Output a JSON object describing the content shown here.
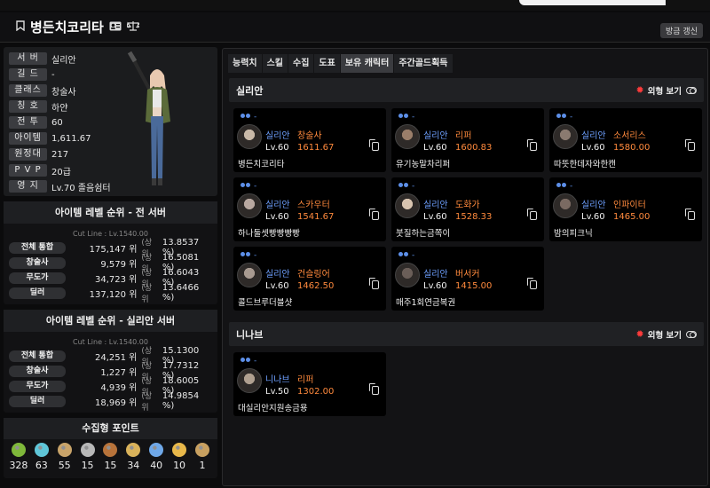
{
  "header": {
    "title": "병든치코리타",
    "refresh_label": "방금 갱신"
  },
  "profile": {
    "rows": [
      {
        "label": "서 버",
        "value": "실리안"
      },
      {
        "label": "길 드",
        "value": "-"
      },
      {
        "label": "클래스",
        "value": "창술사"
      },
      {
        "label": "칭 호",
        "value": "하얀"
      },
      {
        "label": "전 투",
        "value": "60"
      },
      {
        "label": "아이템",
        "value": "1,611.67"
      },
      {
        "label": "원정대",
        "value": "217"
      },
      {
        "label": "P V P",
        "value": "20급"
      },
      {
        "label": "영 지",
        "value": "Lv.70 졸음쉼터"
      }
    ]
  },
  "rank_all": {
    "title": "아이템 레벨 순위 - 전 서버",
    "cutline": "Cut Line : Lv.1540.00",
    "rows": [
      {
        "label": "전체 통합",
        "rank": "175,147 위",
        "top": "(상위",
        "pct": "13.8537 %)"
      },
      {
        "label": "창술사",
        "rank": "9,579 위",
        "top": "(상위",
        "pct": "16.5081 %)"
      },
      {
        "label": "무도가",
        "rank": "34,723 위",
        "top": "(상위",
        "pct": "16.6043 %)"
      },
      {
        "label": "딜러",
        "rank": "137,120 위",
        "top": "(상위",
        "pct": "13.6466 %)"
      }
    ]
  },
  "rank_server": {
    "title": "아이템 레벨 순위 - 실리안 서버",
    "cutline": "Cut Line : Lv.1540.00",
    "rows": [
      {
        "label": "전체 통합",
        "rank": "24,251 위",
        "top": "(상위",
        "pct": "15.1300 %)"
      },
      {
        "label": "창술사",
        "rank": "1,227 위",
        "top": "(상위",
        "pct": "17.7312 %)"
      },
      {
        "label": "무도가",
        "rank": "4,939 위",
        "top": "(상위",
        "pct": "18.6005 %)"
      },
      {
        "label": "딜러",
        "rank": "18,969 위",
        "top": "(상위",
        "pct": "14.9854 %)"
      }
    ]
  },
  "collect": {
    "title": "수집형 포인트",
    "items": [
      {
        "icon": "mokoko-seed-icon",
        "value": "328",
        "color": "#7fb83a"
      },
      {
        "icon": "island-heart-icon",
        "value": "63",
        "color": "#5fc6d8"
      },
      {
        "icon": "great-art-icon",
        "value": "55",
        "color": "#c9a46a"
      },
      {
        "icon": "giant-heart-icon",
        "value": "15",
        "color": "#b8b8b8"
      },
      {
        "icon": "ignea-token-icon",
        "value": "15",
        "color": "#b8733a"
      },
      {
        "icon": "sea-bounty-icon",
        "value": "34",
        "color": "#d9b25a"
      },
      {
        "icon": "world-tree-leaf-icon",
        "value": "40",
        "color": "#6fa8e8"
      },
      {
        "icon": "orpheus-star-icon",
        "value": "10",
        "color": "#e8b84a"
      },
      {
        "icon": "orchestra-icon",
        "value": "1",
        "color": "#c8a060"
      }
    ]
  },
  "tabs": [
    "능력치",
    "스킬",
    "수집",
    "도표",
    "보유 캐릭터",
    "주간골드획득"
  ],
  "active_tab": 4,
  "sections": [
    {
      "title": "실리안",
      "visibility_label": "외형 보기",
      "cards": [
        {
          "guild": "-",
          "server": "실리안",
          "class": "창술사",
          "lv": "Lv.60",
          "il": "1611.67",
          "name": "병든치코리타"
        },
        {
          "guild": "-",
          "server": "실리안",
          "class": "리퍼",
          "lv": "Lv.60",
          "il": "1600.83",
          "name": "유기농말차리퍼"
        },
        {
          "guild": "-",
          "server": "실리안",
          "class": "소서리스",
          "lv": "Lv.60",
          "il": "1580.00",
          "name": "따뜻한데자와한캔"
        },
        {
          "guild": "-",
          "server": "실리안",
          "class": "스카우터",
          "lv": "Lv.60",
          "il": "1541.67",
          "name": "하나둘셋빵빵빵빵"
        },
        {
          "guild": "-",
          "server": "실리안",
          "class": "도화가",
          "lv": "Lv.60",
          "il": "1528.33",
          "name": "붓질하는금쪽이"
        },
        {
          "guild": "-",
          "server": "실리안",
          "class": "인파이터",
          "lv": "Lv.60",
          "il": "1465.00",
          "name": "밤의피크닉"
        },
        {
          "guild": "-",
          "server": "실리안",
          "class": "건슬링어",
          "lv": "Lv.60",
          "il": "1462.50",
          "name": "콜드브루더블샷"
        },
        {
          "guild": "-",
          "server": "실리안",
          "class": "버서커",
          "lv": "Lv.60",
          "il": "1415.00",
          "name": "매주1회연금복권"
        }
      ]
    },
    {
      "title": "니나브",
      "visibility_label": "외형 보기",
      "cards": [
        {
          "guild": "-",
          "server": "니나브",
          "class": "리퍼",
          "lv": "Lv.50",
          "il": "1302.00",
          "name": "대실리안지원송금용"
        }
      ]
    }
  ]
}
